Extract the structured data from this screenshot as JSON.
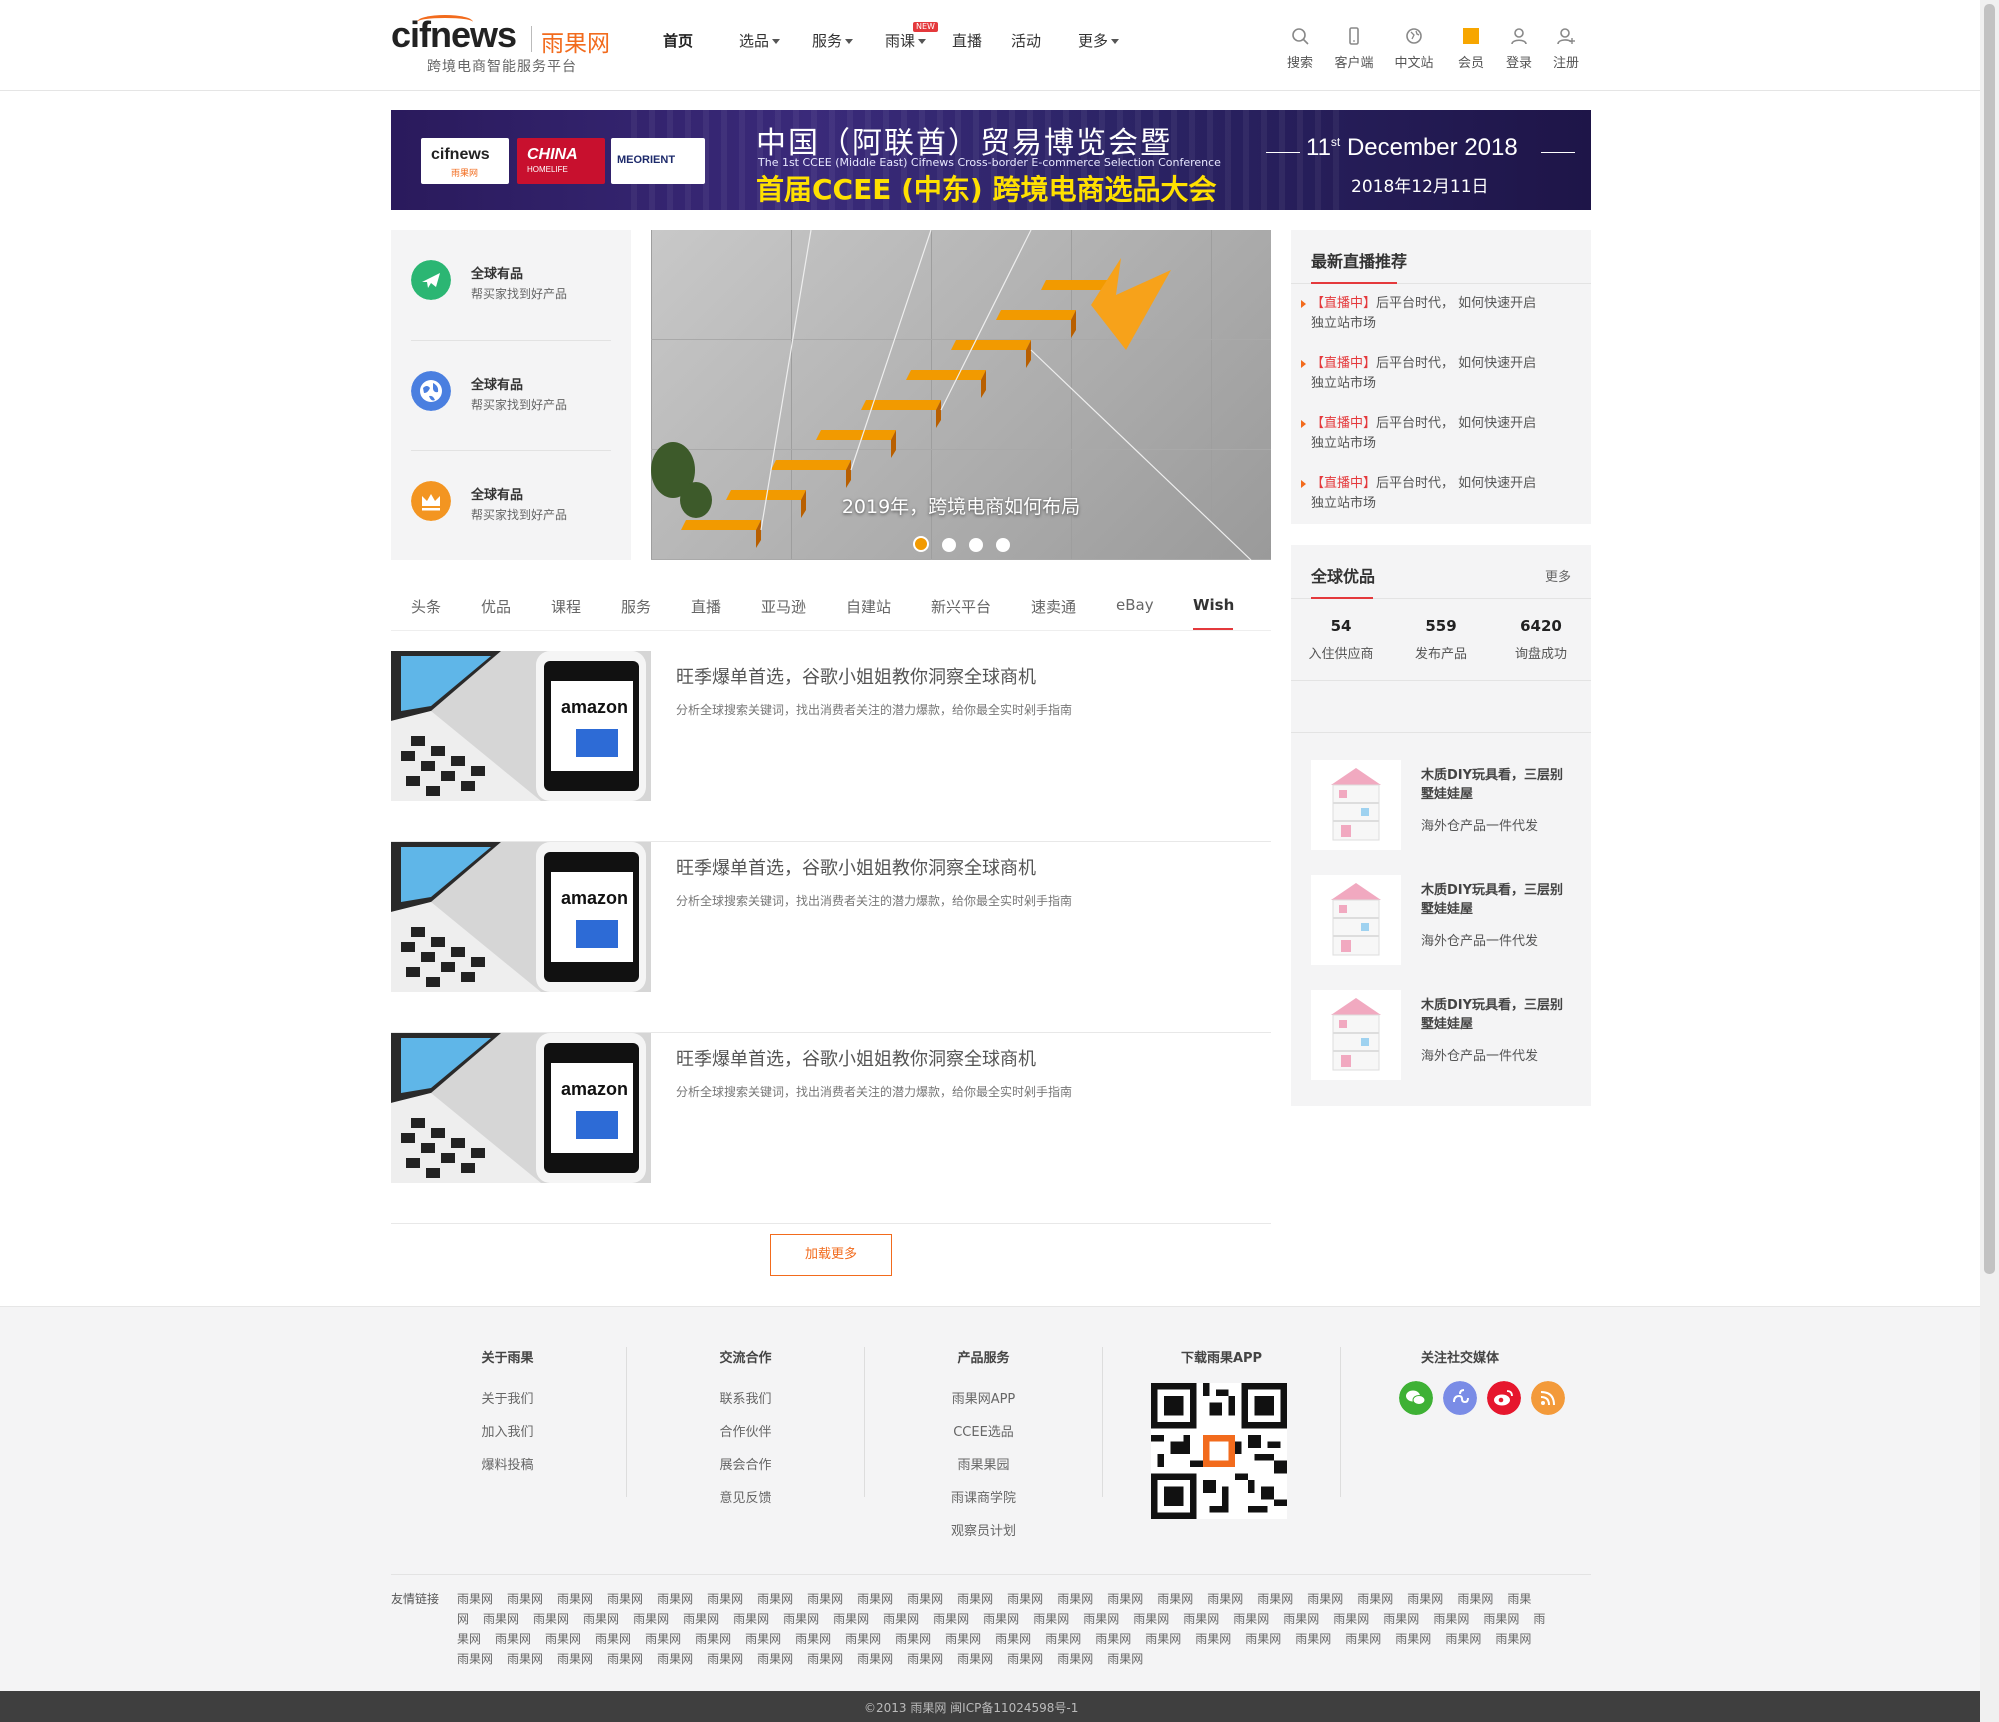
{
  "header": {
    "logo_en": "cifnews",
    "logo_cn": "雨果网",
    "logo_sub": "跨境电商智能服务平台",
    "nav": [
      {
        "label": "首页",
        "active": true
      },
      {
        "label": "选品",
        "dropdown": true
      },
      {
        "label": "服务",
        "dropdown": true
      },
      {
        "label": "雨课",
        "dropdown": true,
        "badge": "NEW"
      },
      {
        "label": "直播"
      },
      {
        "label": "活动"
      },
      {
        "label": "更多",
        "dropdown": true
      }
    ],
    "tools": [
      {
        "label": "搜索",
        "icon": "search-icon"
      },
      {
        "label": "客户端",
        "icon": "mobile-icon"
      },
      {
        "label": "中文站",
        "icon": "globe-icon"
      },
      {
        "label": "会员",
        "icon": "vip-icon"
      },
      {
        "label": "登录",
        "icon": "user-icon"
      },
      {
        "label": "注册",
        "icon": "user-add-icon"
      }
    ]
  },
  "banner": {
    "logos": [
      "cifnews",
      "雨果网",
      "CHINA",
      "HOMELIFE",
      "MEORIENT"
    ],
    "title_cn": "中国（阿联酋）贸易博览会暨",
    "title_en": "The 1st CCEE (Middle East) Cifnews Cross-border E-commerce Selection Conference",
    "title_main": "首届CCEE (中东) 跨境电商选品大会",
    "date_en_day": "11",
    "date_en_sup": "st",
    "date_en_rest": "December 2018",
    "date_cn": "2018年12月11日"
  },
  "features": [
    {
      "title": "全球有品",
      "desc": "帮买家找到好产品",
      "icon": "plane-icon",
      "color": "#2bb673"
    },
    {
      "title": "全球有品",
      "desc": "帮买家找到好产品",
      "icon": "globe-icon",
      "color": "#4a7fe0"
    },
    {
      "title": "全球有品",
      "desc": "帮买家找到好产品",
      "icon": "crown-icon",
      "color": "#f39521"
    }
  ],
  "carousel": {
    "caption": "2019年，跨境电商如何布局",
    "slide_count": 4,
    "active_index": 0
  },
  "tabs": [
    {
      "label": "头条"
    },
    {
      "label": "优品"
    },
    {
      "label": "课程"
    },
    {
      "label": "服务"
    },
    {
      "label": "直播"
    },
    {
      "label": "亚马逊"
    },
    {
      "label": "自建站"
    },
    {
      "label": "新兴平台"
    },
    {
      "label": "速卖通"
    },
    {
      "label": "eBay"
    },
    {
      "label": "Wish",
      "active": true
    }
  ],
  "articles": [
    {
      "title": "旺季爆单首选，谷歌小姐姐教你洞察全球商机",
      "desc": "分析全球搜索关键词，找出消费者关注的潜力爆款，给你最全实时剁手指南",
      "image_text": "amazon"
    },
    {
      "title": "旺季爆单首选，谷歌小姐姐教你洞察全球商机",
      "desc": "分析全球搜索关键词，找出消费者关注的潜力爆款，给你最全实时剁手指南",
      "image_text": "amazon"
    },
    {
      "title": "旺季爆单首选，谷歌小姐姐教你洞察全球商机",
      "desc": "分析全球搜索关键词，找出消费者关注的潜力爆款，给你最全实时剁手指南",
      "image_text": "amazon"
    }
  ],
  "load_more": "加载更多",
  "live": {
    "title": "最新直播推荐",
    "items": [
      {
        "tag": "【直播中】",
        "line1": "后平台时代， 如何快速开启",
        "line2": "独立站市场"
      },
      {
        "tag": "【直播中】",
        "line1": "后平台时代， 如何快速开启",
        "line2": "独立站市场"
      },
      {
        "tag": "【直播中】",
        "line1": "后平台时代， 如何快速开启",
        "line2": "独立站市场"
      },
      {
        "tag": "【直播中】",
        "line1": "后平台时代， 如何快速开启",
        "line2": "独立站市场"
      }
    ]
  },
  "products": {
    "title": "全球优品",
    "more": "更多",
    "stats": [
      {
        "num": "54",
        "label": "入住供应商"
      },
      {
        "num": "559",
        "label": "发布产品"
      },
      {
        "num": "6420",
        "label": "询盘成功"
      }
    ],
    "items": [
      {
        "title": "木质DIY玩具看，三层别墅娃娃屋",
        "desc": "海外仓产品一件代发"
      },
      {
        "title": "木质DIY玩具看，三层别墅娃娃屋",
        "desc": "海外仓产品一件代发"
      },
      {
        "title": "木质DIY玩具看，三层别墅娃娃屋",
        "desc": "海外仓产品一件代发"
      }
    ]
  },
  "footer": {
    "columns": [
      {
        "title": "关于雨果",
        "links": [
          "关于我们",
          "加入我们",
          "爆料投稿"
        ]
      },
      {
        "title": "交流合作",
        "links": [
          "联系我们",
          "合作伙伴",
          "展会合作",
          "意见反馈"
        ]
      },
      {
        "title": "产品服务",
        "links": [
          "雨果网APP",
          "CCEE选品",
          "雨果果园",
          "雨课商学院",
          "观察员计划"
        ]
      },
      {
        "title": "下载雨果APP",
        "links": []
      },
      {
        "title": "关注社交媒体",
        "links": []
      }
    ],
    "social": [
      {
        "icon": "wechat-icon",
        "color": "#3eb135"
      },
      {
        "icon": "miniprogram-icon",
        "color": "#7a8ce6"
      },
      {
        "icon": "weibo-icon",
        "color": "#e6162d"
      },
      {
        "icon": "rss-icon",
        "color": "#f39a3a"
      }
    ],
    "friend_label": "友情链接",
    "friend_link_text": "雨果网",
    "friend_link_count": 79,
    "copyright": "©2013 雨果网 闽ICP备11024598号-1"
  }
}
